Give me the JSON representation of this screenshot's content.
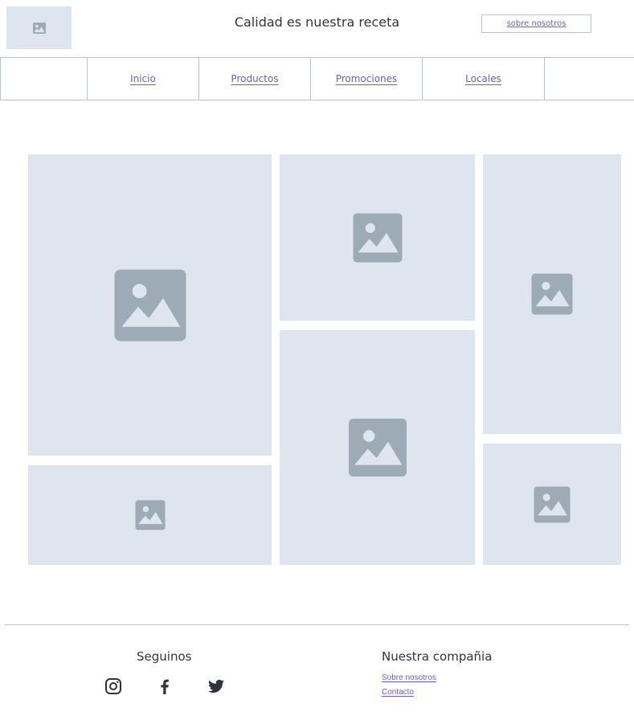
{
  "header": {
    "logo_icon": "image-placeholder-icon",
    "title": "Calidad es nuestra receta",
    "about_button": "sobre nosotros"
  },
  "nav": {
    "items": [
      {
        "label": "Inicio"
      },
      {
        "label": "Productos"
      },
      {
        "label": "Promociones"
      },
      {
        "label": "Locales"
      }
    ]
  },
  "gallery": {
    "tile_icon": "image-placeholder-icon",
    "tile_color": "#dfe5ee",
    "icon_color": "#9dabb7"
  },
  "footer": {
    "social_heading": "Seguinos",
    "social_icons": [
      "instagram-icon",
      "facebook-icon",
      "twitter-icon"
    ],
    "company_heading": "Nuestra compañia",
    "links": [
      {
        "label": "Sobre nosotros"
      },
      {
        "label": "Contacto"
      }
    ]
  },
  "colors": {
    "link": "#6a5ad6",
    "text": "#2f3440",
    "border": "#b9c2cf"
  }
}
